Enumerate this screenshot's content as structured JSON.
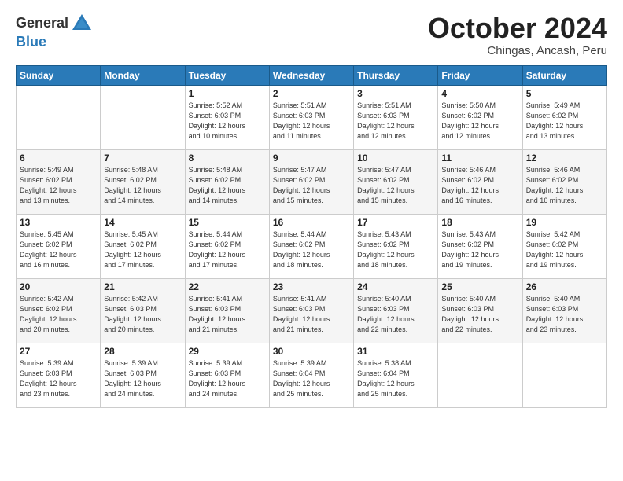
{
  "logo": {
    "general": "General",
    "blue": "Blue"
  },
  "title": "October 2024",
  "subtitle": "Chingas, Ancash, Peru",
  "headers": [
    "Sunday",
    "Monday",
    "Tuesday",
    "Wednesday",
    "Thursday",
    "Friday",
    "Saturday"
  ],
  "weeks": [
    [
      {
        "day": "",
        "info": ""
      },
      {
        "day": "",
        "info": ""
      },
      {
        "day": "1",
        "info": "Sunrise: 5:52 AM\nSunset: 6:03 PM\nDaylight: 12 hours\nand 10 minutes."
      },
      {
        "day": "2",
        "info": "Sunrise: 5:51 AM\nSunset: 6:03 PM\nDaylight: 12 hours\nand 11 minutes."
      },
      {
        "day": "3",
        "info": "Sunrise: 5:51 AM\nSunset: 6:03 PM\nDaylight: 12 hours\nand 12 minutes."
      },
      {
        "day": "4",
        "info": "Sunrise: 5:50 AM\nSunset: 6:02 PM\nDaylight: 12 hours\nand 12 minutes."
      },
      {
        "day": "5",
        "info": "Sunrise: 5:49 AM\nSunset: 6:02 PM\nDaylight: 12 hours\nand 13 minutes."
      }
    ],
    [
      {
        "day": "6",
        "info": "Sunrise: 5:49 AM\nSunset: 6:02 PM\nDaylight: 12 hours\nand 13 minutes."
      },
      {
        "day": "7",
        "info": "Sunrise: 5:48 AM\nSunset: 6:02 PM\nDaylight: 12 hours\nand 14 minutes."
      },
      {
        "day": "8",
        "info": "Sunrise: 5:48 AM\nSunset: 6:02 PM\nDaylight: 12 hours\nand 14 minutes."
      },
      {
        "day": "9",
        "info": "Sunrise: 5:47 AM\nSunset: 6:02 PM\nDaylight: 12 hours\nand 15 minutes."
      },
      {
        "day": "10",
        "info": "Sunrise: 5:47 AM\nSunset: 6:02 PM\nDaylight: 12 hours\nand 15 minutes."
      },
      {
        "day": "11",
        "info": "Sunrise: 5:46 AM\nSunset: 6:02 PM\nDaylight: 12 hours\nand 16 minutes."
      },
      {
        "day": "12",
        "info": "Sunrise: 5:46 AM\nSunset: 6:02 PM\nDaylight: 12 hours\nand 16 minutes."
      }
    ],
    [
      {
        "day": "13",
        "info": "Sunrise: 5:45 AM\nSunset: 6:02 PM\nDaylight: 12 hours\nand 16 minutes."
      },
      {
        "day": "14",
        "info": "Sunrise: 5:45 AM\nSunset: 6:02 PM\nDaylight: 12 hours\nand 17 minutes."
      },
      {
        "day": "15",
        "info": "Sunrise: 5:44 AM\nSunset: 6:02 PM\nDaylight: 12 hours\nand 17 minutes."
      },
      {
        "day": "16",
        "info": "Sunrise: 5:44 AM\nSunset: 6:02 PM\nDaylight: 12 hours\nand 18 minutes."
      },
      {
        "day": "17",
        "info": "Sunrise: 5:43 AM\nSunset: 6:02 PM\nDaylight: 12 hours\nand 18 minutes."
      },
      {
        "day": "18",
        "info": "Sunrise: 5:43 AM\nSunset: 6:02 PM\nDaylight: 12 hours\nand 19 minutes."
      },
      {
        "day": "19",
        "info": "Sunrise: 5:42 AM\nSunset: 6:02 PM\nDaylight: 12 hours\nand 19 minutes."
      }
    ],
    [
      {
        "day": "20",
        "info": "Sunrise: 5:42 AM\nSunset: 6:02 PM\nDaylight: 12 hours\nand 20 minutes."
      },
      {
        "day": "21",
        "info": "Sunrise: 5:42 AM\nSunset: 6:03 PM\nDaylight: 12 hours\nand 20 minutes."
      },
      {
        "day": "22",
        "info": "Sunrise: 5:41 AM\nSunset: 6:03 PM\nDaylight: 12 hours\nand 21 minutes."
      },
      {
        "day": "23",
        "info": "Sunrise: 5:41 AM\nSunset: 6:03 PM\nDaylight: 12 hours\nand 21 minutes."
      },
      {
        "day": "24",
        "info": "Sunrise: 5:40 AM\nSunset: 6:03 PM\nDaylight: 12 hours\nand 22 minutes."
      },
      {
        "day": "25",
        "info": "Sunrise: 5:40 AM\nSunset: 6:03 PM\nDaylight: 12 hours\nand 22 minutes."
      },
      {
        "day": "26",
        "info": "Sunrise: 5:40 AM\nSunset: 6:03 PM\nDaylight: 12 hours\nand 23 minutes."
      }
    ],
    [
      {
        "day": "27",
        "info": "Sunrise: 5:39 AM\nSunset: 6:03 PM\nDaylight: 12 hours\nand 23 minutes."
      },
      {
        "day": "28",
        "info": "Sunrise: 5:39 AM\nSunset: 6:03 PM\nDaylight: 12 hours\nand 24 minutes."
      },
      {
        "day": "29",
        "info": "Sunrise: 5:39 AM\nSunset: 6:03 PM\nDaylight: 12 hours\nand 24 minutes."
      },
      {
        "day": "30",
        "info": "Sunrise: 5:39 AM\nSunset: 6:04 PM\nDaylight: 12 hours\nand 25 minutes."
      },
      {
        "day": "31",
        "info": "Sunrise: 5:38 AM\nSunset: 6:04 PM\nDaylight: 12 hours\nand 25 minutes."
      },
      {
        "day": "",
        "info": ""
      },
      {
        "day": "",
        "info": ""
      }
    ]
  ]
}
